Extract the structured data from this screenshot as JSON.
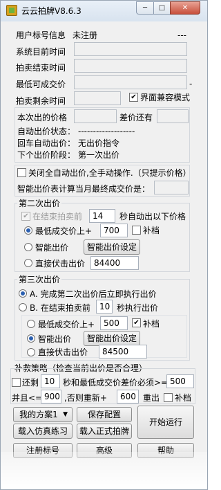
{
  "window": {
    "title": "云云拍牌V8.6.3",
    "min": "─",
    "max": "□",
    "close": "✕"
  },
  "user": {
    "label": "用户标号信息",
    "value": "未注册",
    "extra": "---"
  },
  "times": {
    "system_time": "系统目前时间",
    "auction_end": "拍卖结束时间",
    "min_price": "最低可成交价",
    "min_price_suffix": "-",
    "remaining": "拍卖剩余时间",
    "compat_mode": "界面兼容模式"
  },
  "bid_info": {
    "current_price": "本次出的价格",
    "diff": "差价还有",
    "auto_status_label": "自动出价状态：",
    "auto_status_value": "-------------------",
    "enter_auto_label": "回车自动出价：",
    "enter_auto_value": "无出价指令",
    "next_stage_label": "下个出价阶段：",
    "next_stage_value": "第一次出价"
  },
  "manual_mode": "关闭全自动出价,全手动操作.（只提示价格）",
  "smart_calc": "智能出价表计算当月最终成交价是：",
  "second_bid": {
    "title": "第二次出价",
    "at_end_before": "在结束拍卖前",
    "seconds": "14",
    "auto_bid_below": "秒自动出以下价格",
    "min_plus_label": "最低成交价上+",
    "min_plus_value": "700",
    "supplement": "补档",
    "smart_label": "智能出价",
    "smart_btn": "智能出价设定",
    "direct_label": "直接伏击出价",
    "direct_value": "84400"
  },
  "third_bid": {
    "title": "第三次出价",
    "option_a": "A. 完成第二次出价后立即执行出价",
    "option_b_pre": "B. 在结束拍卖前",
    "option_b_seconds": "10",
    "option_b_post": "秒执行出价",
    "min_plus_label": "最低成交价上+",
    "min_plus_value": "500",
    "supplement": "补档",
    "smart_label": "智能出价",
    "smart_btn": "智能出价设定",
    "direct_label": "直接伏击出价",
    "direct_value": "84500"
  },
  "rescue": {
    "title": "补救策略（检查当前出价是否合理）",
    "remain_label": "还剩",
    "remain_value": "10",
    "diff_label": "秒和最低成交价差价必须>=",
    "diff_value": "500",
    "and_label": "并且<=",
    "and_value": "900",
    "reset_label": ",否则重新+",
    "reset_value": "600",
    "rebid_label": "重出",
    "supplement": "补档"
  },
  "footer": {
    "plan_select": "我的方案1",
    "save_config": "保存配置",
    "start": "开始运行",
    "load_sim": "载入仿真练习",
    "load_real": "载入正式拍牌",
    "register": "注册标号",
    "advanced": "高级",
    "help": "帮助"
  }
}
